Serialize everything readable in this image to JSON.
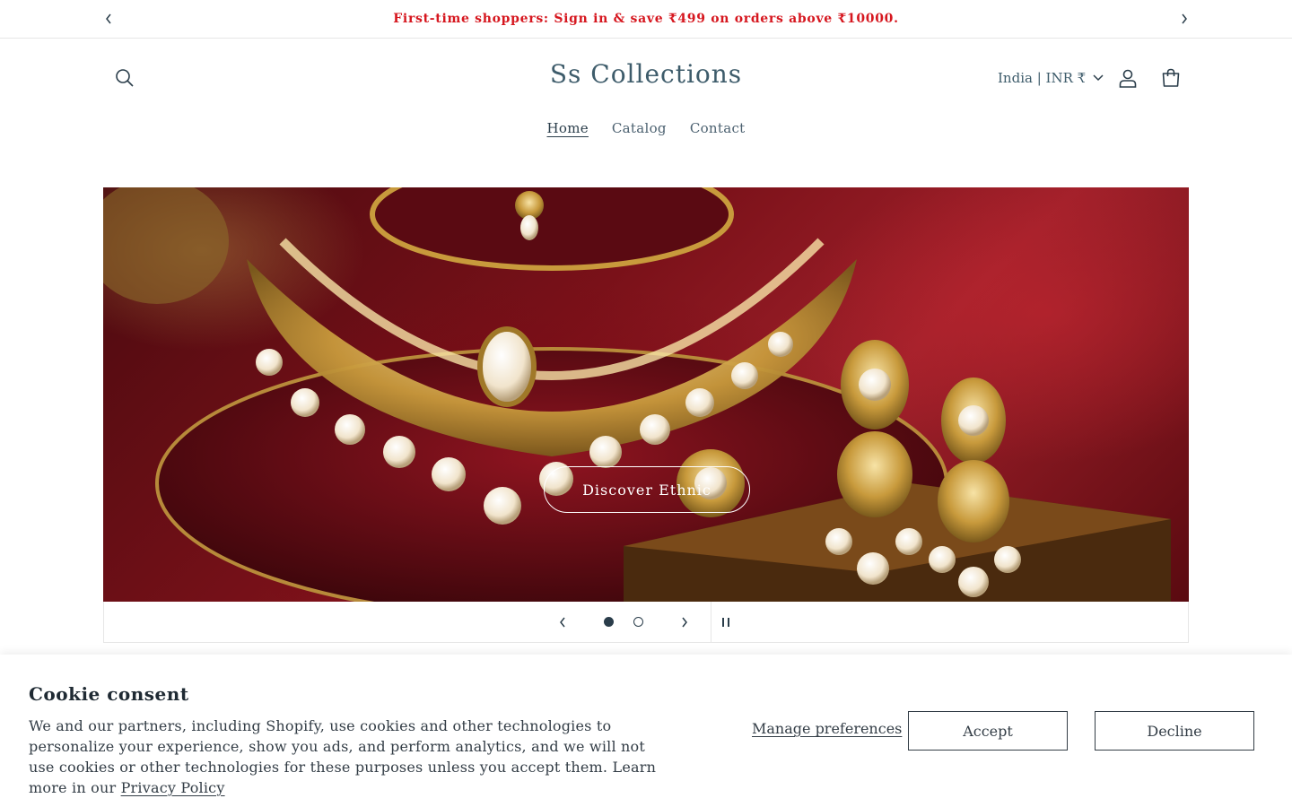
{
  "announcement": {
    "text": "First-time shoppers: Sign in & save ₹499 on orders above ₹10000."
  },
  "header": {
    "logo": "Ss Collections",
    "locale": "India | INR ₹"
  },
  "nav": {
    "items": [
      {
        "label": "Home",
        "active": true
      },
      {
        "label": "Catalog",
        "active": false
      },
      {
        "label": "Contact",
        "active": false
      }
    ]
  },
  "hero": {
    "button_label": "Discover Ethnic",
    "slide_count": 2,
    "current_slide": 1
  },
  "cookie": {
    "title": "Cookie consent",
    "body": "We and our partners, including Shopify, use cookies and other technologies to personalize your experience, show you ads, and perform analytics, and we will not use cookies or other technologies for these purposes unless you accept them. Learn more in our ",
    "privacy_link": "Privacy Policy",
    "manage_label": "Manage preferences",
    "accept_label": "Accept",
    "decline_label": "Decline"
  },
  "colors": {
    "announcement_text": "#d6171f",
    "brand_text": "#3e5c6b",
    "hero_red": "#7a1119"
  },
  "icons": {
    "search": "search-icon",
    "account": "account-icon",
    "cart": "cart-icon",
    "locale_chevron": "chevron-down-icon",
    "pause": "pause-icon"
  }
}
